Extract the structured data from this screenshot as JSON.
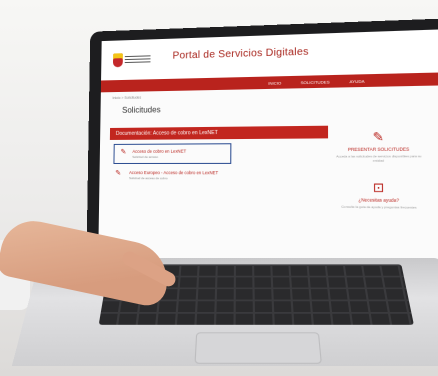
{
  "site": {
    "title": "Portal de Servicios Digitales",
    "nav": [
      "INICIO",
      "SOLICITUDES",
      "AYUDA"
    ]
  },
  "breadcrumb": "Inicio > Solicitudes",
  "page": {
    "heading": "Solicitudes"
  },
  "section": {
    "title": "Documentación: Acceso de cobro en LexNET",
    "items": [
      {
        "label": "Acceso de cobro en LexNET",
        "sub": "Solicitud de acceso",
        "selected": true
      },
      {
        "label": "Acceso Europeo - Acceso de cobro en LexNET",
        "sub": "Solicitud de acceso de cobro",
        "selected": false
      }
    ]
  },
  "sidebar": {
    "cards": [
      {
        "icon": "edit-icon",
        "title": "PRESENTAR SOLICITUDES",
        "desc": "Acceda a las solicitudes de servicios disponibles para su entidad"
      },
      {
        "icon": "help-icon",
        "title": "¿Necesitas ayuda?",
        "desc": "Consulte la guía de ayuda y preguntas frecuentes"
      }
    ]
  }
}
